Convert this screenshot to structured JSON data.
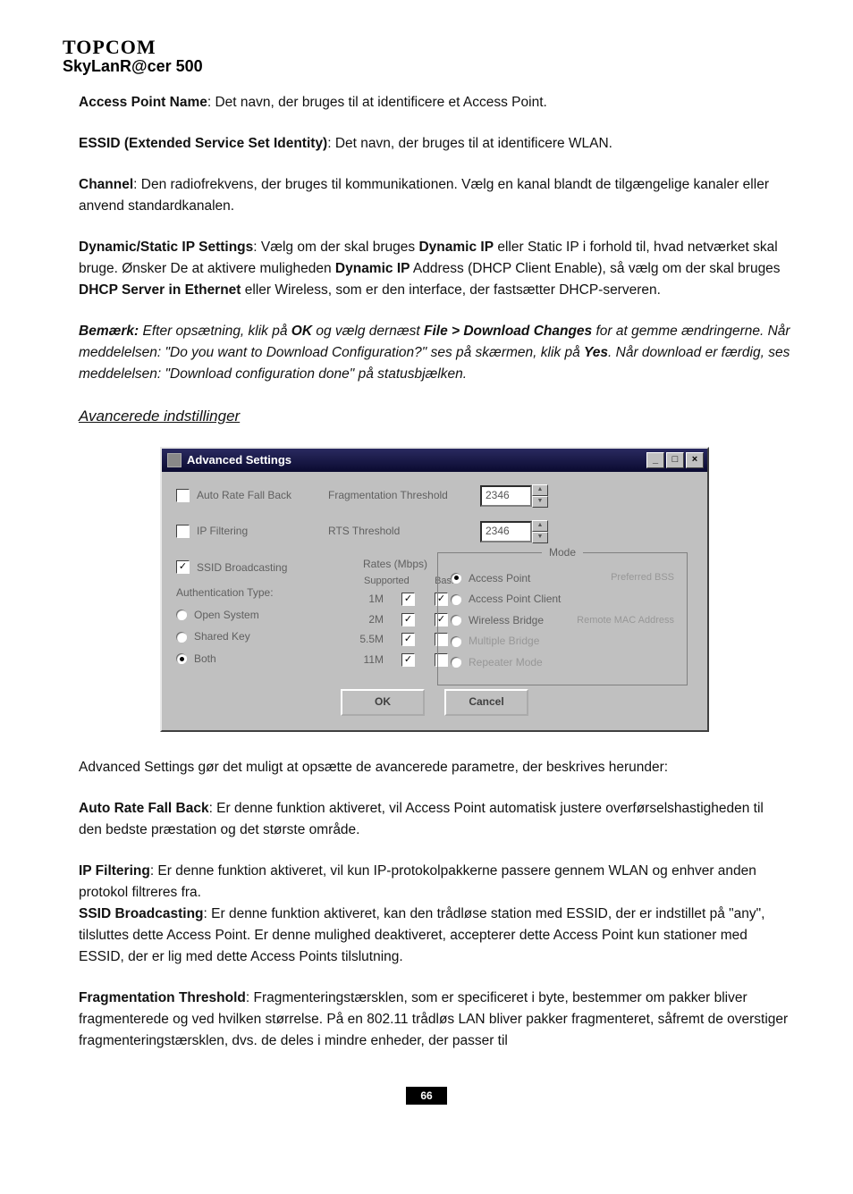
{
  "header": {
    "brand": "TOPCOM",
    "model": "SkyLanR@cer 500"
  },
  "paras": {
    "ap_name_label": "Access Point Name",
    "ap_name_text": ": Det navn, der bruges til at identificere et Access Point.",
    "essid_label": "ESSID (Extended Service Set Identity)",
    "essid_text": ": Det navn, der bruges til at identificere WLAN.",
    "channel_label": "Channel",
    "channel_text": ": Den radiofrekvens, der bruges til kommunikationen. Vælg en kanal blandt de tilgængelige kanaler eller anvend standardkanalen.",
    "dynstat_label": "Dynamic/Static IP Settings",
    "dynstat_text_1": ": Vælg om der skal bruges ",
    "dynstat_b1": "Dynamic IP",
    "dynstat_text_2": " eller Static IP i forhold til, hvad netværket skal bruge. Ønsker De at aktivere muligheden ",
    "dynstat_b2": "Dynamic IP",
    "dynstat_text_3": " Address (DHCP Client Enable), så vælg om der skal bruges ",
    "dynstat_b3": "DHCP Server in Ethernet",
    "dynstat_text_4": " eller Wireless, som er den interface, der fastsætter DHCP-serveren.",
    "note_label": "Bemærk:",
    "note_t1": " Efter opsætning, klik på ",
    "note_b1": "OK",
    "note_t2": " og vælg dernæst ",
    "note_b2": "File > Download Changes",
    "note_t3": " for at gemme ændringerne. Når meddelelsen: \"Do you want to Download Configuration?\" ses på skærmen, klik på ",
    "note_b3": "Yes",
    "note_t4": ". Når download er færdig, ses meddelelsen: \"Download configuration done\" på statusbjælken.",
    "section": "Avancerede indstillinger",
    "adv_intro": "Advanced Settings gør det muligt at opsætte de avancerede parametre, der beskrives herunder:",
    "arfb_label": "Auto Rate Fall Back",
    "arfb_text": ": Er denne funktion aktiveret, vil Access Point automatisk justere overførselshastigheden til den bedste præstation og det største område.",
    "ipf_label": "IP Filtering",
    "ipf_text": ": Er denne funktion aktiveret, vil kun IP-protokolpakkerne passere gennem WLAN og enhver anden protokol filtreres fra.",
    "ssid_label": "SSID Broadcasting",
    "ssid_text": ": Er denne funktion aktiveret, kan den trådløse station med ESSID, der er indstillet på \"any\", tilsluttes dette Access Point. Er denne mulighed deaktiveret, accepterer dette Access Point kun stationer med ESSID, der er lig med dette Access Points tilslutning.",
    "frag_label": "Fragmentation Threshold",
    "frag_text": ": Fragmenteringstærsklen, som er specificeret i byte, bestemmer om pakker bliver fragmenterede og ved hvilken størrelse. På en 802.11 trådløs LAN bliver pakker fragmenteret, såfremt de overstiger fragmenteringstærsklen, dvs. de deles i mindre enheder, der passer til"
  },
  "dialog": {
    "title": "Advanced Settings",
    "auto_rate": "Auto Rate Fall Back",
    "frag_th": "Fragmentation Threshold",
    "frag_val": "2346",
    "ip_filter": "IP Filtering",
    "rts_th": "RTS Threshold",
    "rts_val": "2346",
    "ssid_bc": "SSID Broadcasting",
    "auth_type": "Authentication Type:",
    "auth_open": "Open System",
    "auth_shared": "Shared Key",
    "auth_both": "Both",
    "rates_title": "Rates (Mbps)",
    "rates_supported": "Supported",
    "rates_basic": "Basic",
    "rate1": "1M",
    "rate2": "2M",
    "rate3": "5.5M",
    "rate4": "11M",
    "mode_title": "Mode",
    "mode_ap": "Access Point",
    "mode_apc": "Access Point Client",
    "mode_wb": "Wireless Bridge",
    "mode_mb": "Multiple Bridge",
    "mode_rep": "Repeater Mode",
    "pref_bss": "Preferred BSS",
    "remote_mac": "Remote MAC Address",
    "ok": "OK",
    "cancel": "Cancel"
  },
  "pagenum": "66"
}
